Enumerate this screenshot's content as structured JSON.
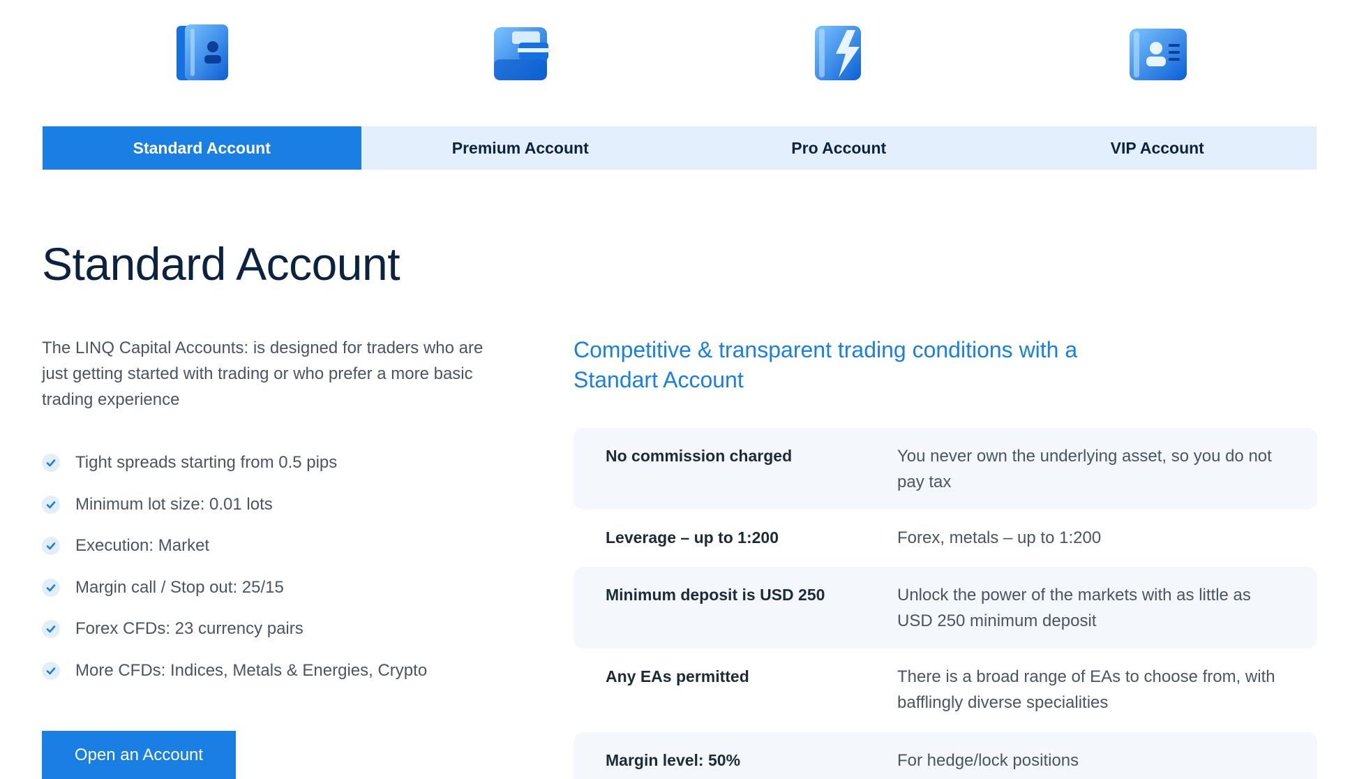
{
  "account_icons": [
    {
      "icon": "id-card-folder-icon"
    },
    {
      "icon": "briefcase-icon"
    },
    {
      "icon": "lightning-card-icon"
    },
    {
      "icon": "user-card-icon"
    }
  ],
  "tabs": [
    {
      "label": "Standard Account",
      "active": true
    },
    {
      "label": "Premium Account",
      "active": false
    },
    {
      "label": "Pro Account",
      "active": false
    },
    {
      "label": "VIP Account",
      "active": false
    }
  ],
  "page": {
    "title": "Standard Account",
    "intro": "The LINQ Capital Accounts: is designed for traders who are just getting started with trading or who prefer a more basic trading experience"
  },
  "features": [
    "Tight spreads starting from 0.5 pips",
    "Minimum lot size: 0.01 lots",
    "Execution: Market",
    "Margin call / Stop out: 25/15",
    "Forex CFDs: 23 currency pairs",
    "More CFDs: Indices, Metals & Energies, Crypto"
  ],
  "cta": {
    "label": "Open an Account"
  },
  "conditions": {
    "heading_line1": "Competitive & transparent trading conditions with a",
    "heading_line2": "Standart Account",
    "rows": [
      {
        "label": "No commission charged",
        "value": "You never own the underlying asset, so you do not pay tax"
      },
      {
        "label": "Leverage – up to 1:200",
        "value": "Forex, metals – up to 1:200"
      },
      {
        "label": "Minimum deposit is USD 250",
        "value": "Unlock the power of the markets with as little as USD 250 minimum deposit"
      },
      {
        "label": "Any EAs permitted",
        "value": "There is a broad range of EAs to choose from, with bafflingly diverse specialities"
      },
      {
        "label": "Margin level: 50%",
        "value": "For hedge/lock positions"
      }
    ]
  },
  "colors": {
    "accent": "#1a7fe2",
    "tab_bg": "#e3effc",
    "heading": "#0b2240",
    "body_text": "#4a5563",
    "row_shade": "#f4f8fd"
  }
}
